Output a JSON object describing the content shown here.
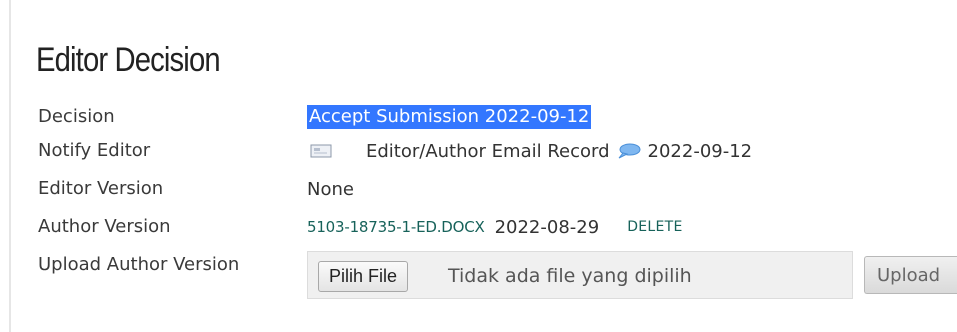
{
  "section": {
    "title": "Editor Decision"
  },
  "rows": {
    "decision": {
      "label": "Decision",
      "value": "Accept Submission 2022-09-12"
    },
    "notify_editor": {
      "label": "Notify Editor",
      "icon": "envelope-icon",
      "record_link": "Editor/Author Email Record",
      "comment_icon": "comment-bubble-icon",
      "date": "2022-09-12"
    },
    "editor_version": {
      "label": "Editor Version",
      "value": "None"
    },
    "author_version": {
      "label": "Author Version",
      "file_name": "5103-18735-1-ED.DOCX",
      "date": "2022-08-29",
      "delete_label": "DELETE"
    },
    "upload_author_version": {
      "label": "Upload Author Version",
      "choose_button": "Pilih File",
      "no_file_text": "Tidak ada file yang dipilih",
      "upload_button": "Upload"
    }
  },
  "colors": {
    "highlight": "#3377ff",
    "link_teal": "#17625a",
    "comment_blue": "#5aa0e6"
  }
}
